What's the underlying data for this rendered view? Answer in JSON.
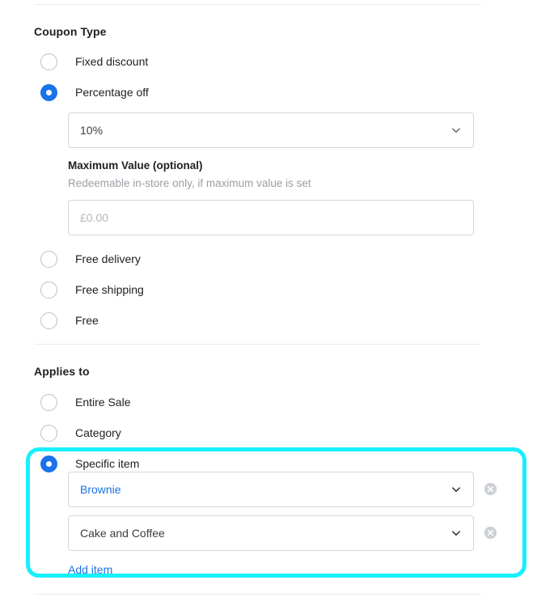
{
  "dividers": {
    "count": 3
  },
  "coupon_type": {
    "heading": "Coupon Type",
    "options": [
      {
        "label": "Fixed discount",
        "selected": false
      },
      {
        "label": "Percentage off",
        "selected": true
      },
      {
        "label": "Free delivery",
        "selected": false
      },
      {
        "label": "Free shipping",
        "selected": false
      },
      {
        "label": "Free",
        "selected": false
      }
    ],
    "percentage_select": {
      "value": "10%",
      "icon": "chevron-down-icon"
    },
    "maximum_value": {
      "label": "Maximum Value (optional)",
      "help": "Redeemable in-store only, if maximum value is set",
      "placeholder": "£0.00",
      "value": ""
    }
  },
  "applies_to": {
    "heading": "Applies to",
    "options": [
      {
        "label": "Entire Sale",
        "selected": false
      },
      {
        "label": "Category",
        "selected": false
      },
      {
        "label": "Specific item",
        "selected": true
      }
    ],
    "items": [
      {
        "value": "Brownie",
        "highlighted": true,
        "remove_icon": "close-circle-icon"
      },
      {
        "value": "Cake and Coffee",
        "highlighted": false,
        "remove_icon": "close-circle-icon"
      }
    ],
    "add_item_label": "Add item"
  },
  "colors": {
    "accent_blue": "#1a73e8",
    "highlight_cyan": "#18f0fb",
    "border_gray": "#d4d6d9",
    "divider_gray": "#ebebeb",
    "placeholder_gray": "#b4b7ba",
    "help_gray": "#9aa0a6",
    "remove_icon_gray": "#cdd1d6"
  }
}
